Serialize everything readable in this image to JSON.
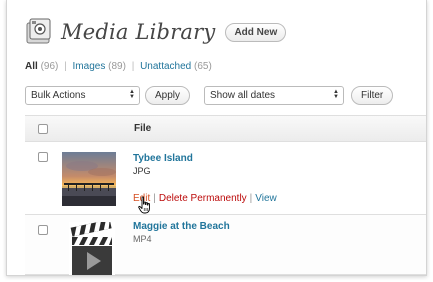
{
  "header": {
    "title": "Media Library",
    "add_new_label": "Add New",
    "icon": "media-library-icon"
  },
  "filters": {
    "all_label": "All",
    "all_count": "(96)",
    "images_label": "Images",
    "images_count": "(89)",
    "unattached_label": "Unattached",
    "unattached_count": "(65)",
    "separator": "|"
  },
  "tablenav": {
    "bulk_actions_selected": "Bulk Actions",
    "apply_label": "Apply",
    "dates_selected": "Show all dates",
    "filter_label": "Filter"
  },
  "table": {
    "column_file": "File",
    "rows": [
      {
        "title": "Tybee Island",
        "type": "JPG",
        "thumbnail": "sunset-pier-photo",
        "actions": {
          "edit": "Edit",
          "delete": "Delete Permanently",
          "view": "View",
          "separator": "|"
        }
      },
      {
        "title": "Maggie at the Beach",
        "type": "MP4",
        "thumbnail": "video-clapper-icon"
      }
    ]
  },
  "colors": {
    "link": "#21759b",
    "edit_hover": "#d54e21",
    "delete": "#bc0b0b",
    "header_gradient_top": "#f9f9f9",
    "header_gradient_bottom": "#ececec"
  }
}
